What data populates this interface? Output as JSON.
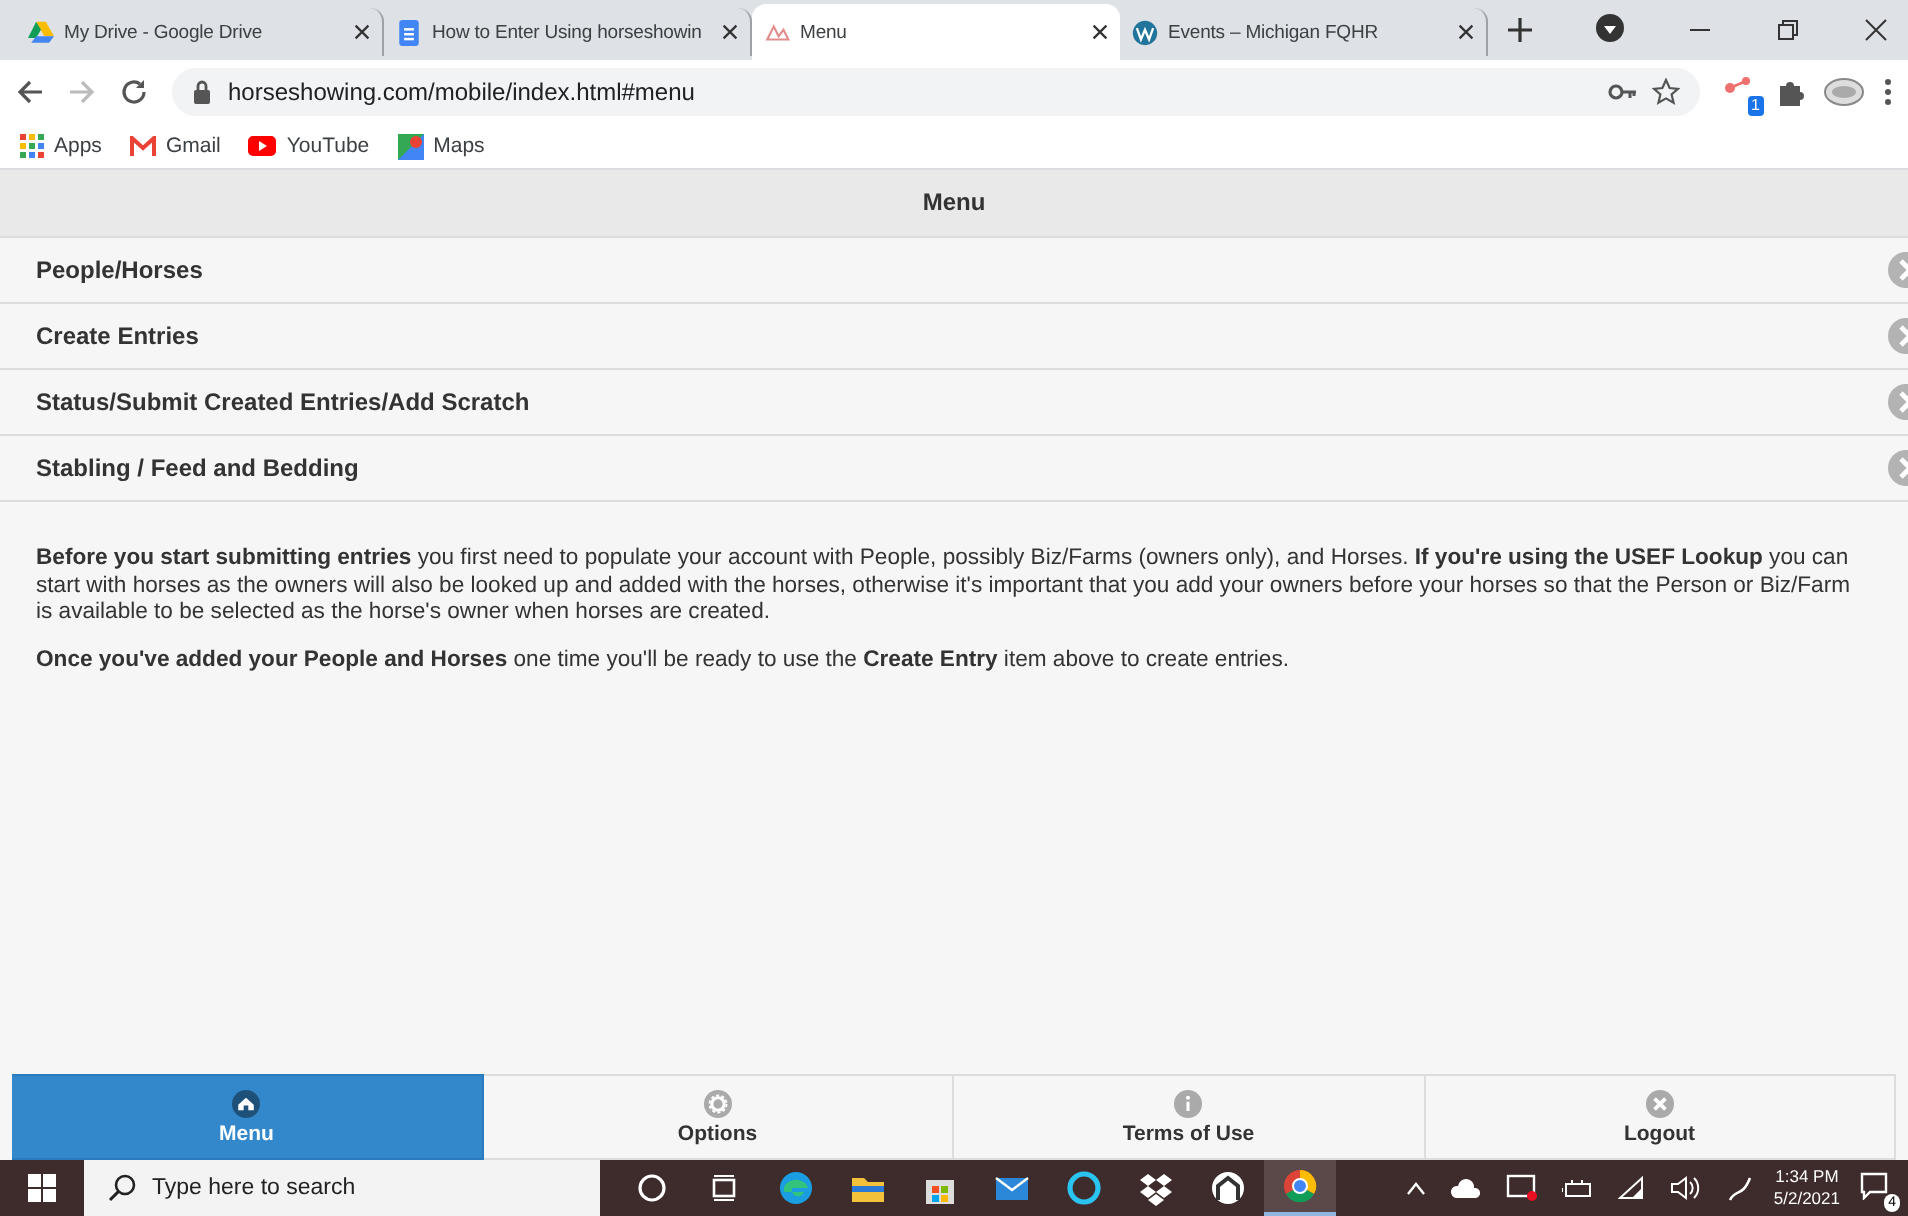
{
  "browser": {
    "tabs": [
      {
        "title": "My Drive - Google Drive",
        "selected": false
      },
      {
        "title": "How to Enter Using horseshowin",
        "selected": false
      },
      {
        "title": "Menu",
        "selected": true
      },
      {
        "title": "Events – Michigan FQHR",
        "selected": false
      }
    ],
    "address": "horseshowing.com/mobile/index.html#menu",
    "extension_badge": "1",
    "bookmarks": [
      "Apps",
      "Gmail",
      "YouTube",
      "Maps"
    ]
  },
  "page": {
    "header": "Menu",
    "menu_items": [
      "People/Horses",
      "Create Entries",
      "Status/Submit Created Entries/Add Scratch",
      "Stabling / Feed and Bedding"
    ],
    "paragraphs": [
      "**Before you start submitting entries** you first need to populate your account with People, possibly Biz/Farms (owners only), and Horses. **If you're using the USEF Lookup** you can start with horses as the owners will also be looked up and added with the horses, otherwise it's important that you add your owners before your horses so that the Person or Biz/Farm is available to be selected as the horse's owner when horses are created.",
      "**Once you've added your People and Horses** one time you'll be ready to use the **Create Entry** item above to create entries."
    ],
    "nav_bar": [
      {
        "label": "Menu",
        "selected": true
      },
      {
        "label": "Options",
        "selected": false
      },
      {
        "label": "Terms of Use",
        "selected": false
      },
      {
        "label": "Logout",
        "selected": false
      }
    ]
  },
  "taskbar": {
    "search": {
      "placeholder": "Type here to search"
    },
    "time": "1:34 PM",
    "date": "5/2/2021",
    "notifications": "4"
  }
}
